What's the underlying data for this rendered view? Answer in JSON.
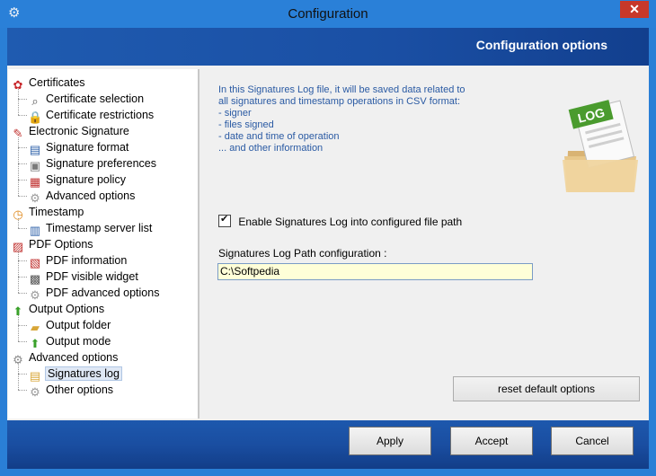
{
  "window": {
    "title": "Configuration",
    "close_glyph": "✕",
    "app_icon": "gear-icon"
  },
  "banner": {
    "title": "Configuration options"
  },
  "tree": {
    "items": [
      {
        "label": "Certificates",
        "icon": "award-icon",
        "level": 0
      },
      {
        "label": "Certificate selection",
        "icon": "magnifier-icon",
        "level": 1
      },
      {
        "label": "Certificate restrictions",
        "icon": "lock-icon",
        "level": 1
      },
      {
        "label": "Electronic Signature",
        "icon": "pen-icon",
        "level": 0
      },
      {
        "label": "Signature format",
        "icon": "document-icon",
        "level": 1
      },
      {
        "label": "Signature preferences",
        "icon": "clipboard-icon",
        "level": 1
      },
      {
        "label": "Signature policy",
        "icon": "policy-icon",
        "level": 1
      },
      {
        "label": "Advanced options",
        "icon": "gear-icon",
        "level": 1
      },
      {
        "label": "Timestamp",
        "icon": "clock-icon",
        "level": 0
      },
      {
        "label": "Timestamp server list",
        "icon": "server-icon",
        "level": 1
      },
      {
        "label": "PDF Options",
        "icon": "pdf-icon",
        "level": 0
      },
      {
        "label": "PDF information",
        "icon": "pdf-info-icon",
        "level": 1
      },
      {
        "label": "PDF visible widget",
        "icon": "widget-icon",
        "level": 1
      },
      {
        "label": "PDF advanced options",
        "icon": "gear-icon",
        "level": 1
      },
      {
        "label": "Output Options",
        "icon": "up-arrow-icon",
        "level": 0
      },
      {
        "label": "Output folder",
        "icon": "folder-icon",
        "level": 1
      },
      {
        "label": "Output mode",
        "icon": "up-arrow-circle-icon",
        "level": 1
      },
      {
        "label": "Advanced options",
        "icon": "gears-icon",
        "level": 0
      },
      {
        "label": "Signatures log",
        "icon": "log-icon",
        "level": 1,
        "selected": true
      },
      {
        "label": "Other options",
        "icon": "gear-icon",
        "level": 1
      }
    ]
  },
  "content": {
    "info_text": "In this Signatures Log file, it will be saved data related to\nall signatures and timestamp operations in CSV format:\n- signer\n- files signed\n- date and time of operation\n... and other information",
    "log_icon_label": "LOG",
    "enable_checkbox": {
      "label": "Enable Signatures Log into configured file path",
      "checked": true
    },
    "path_label": "Signatures Log Path configuration :",
    "path_value": "C:\\Softpedia",
    "reset_label": "reset default options"
  },
  "footer": {
    "apply": "Apply",
    "accept": "Accept",
    "cancel": "Cancel"
  }
}
